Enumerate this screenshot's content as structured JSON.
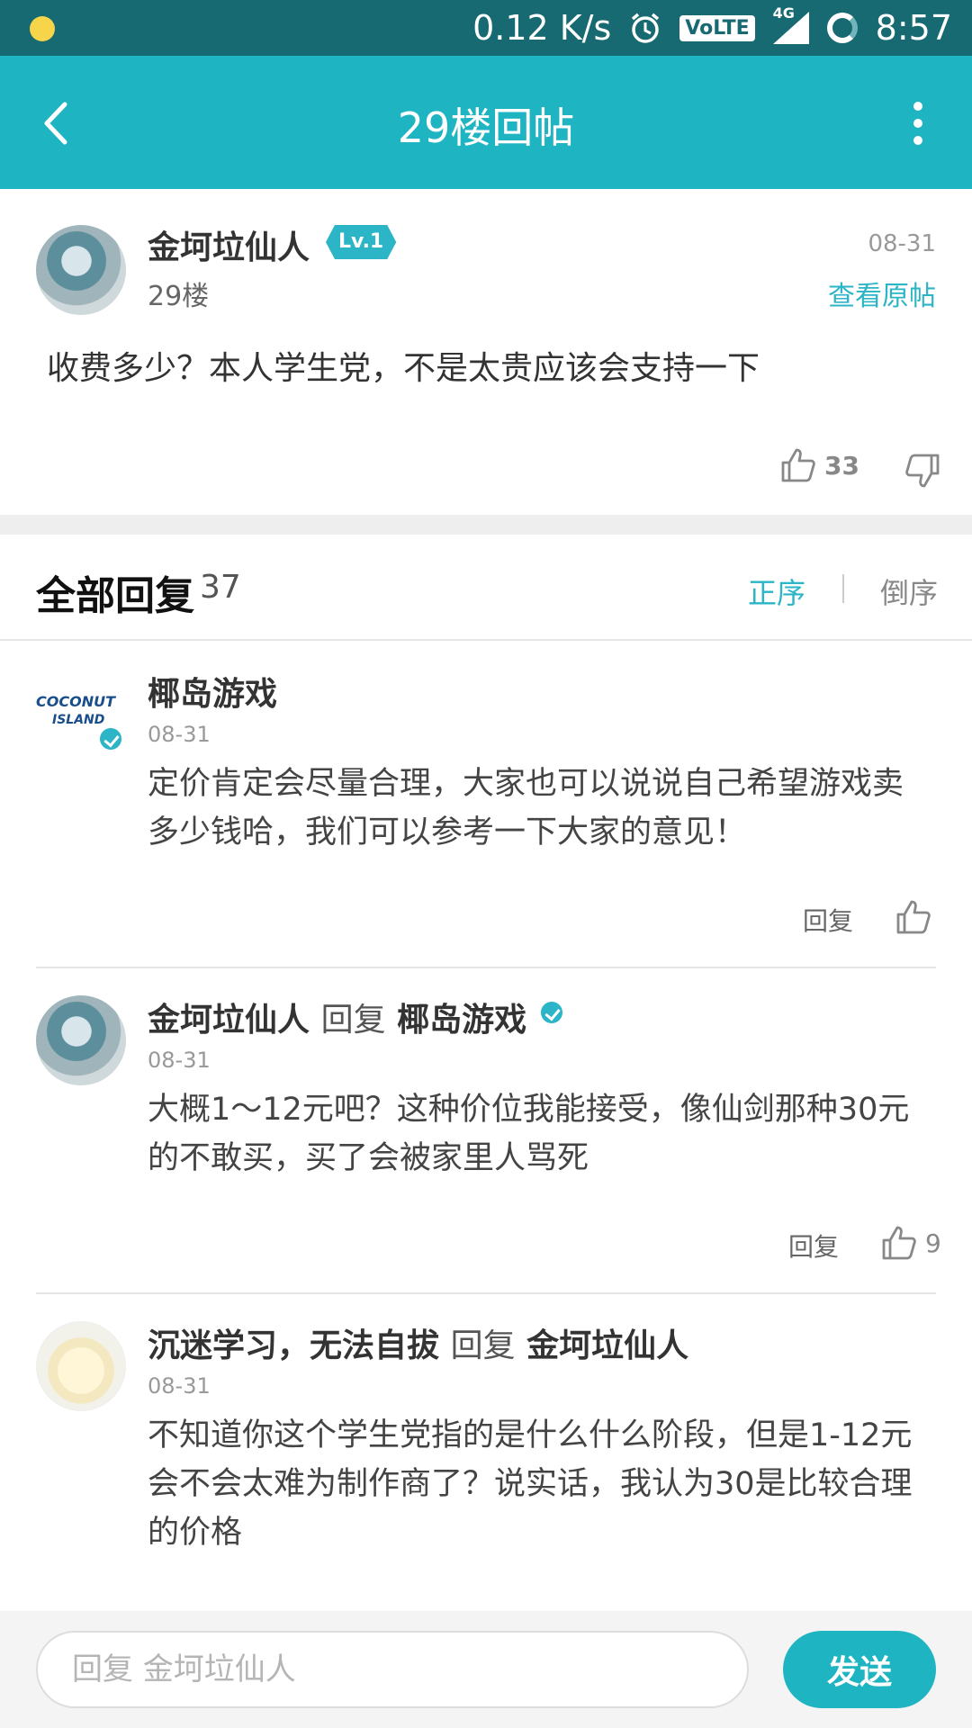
{
  "status_bar": {
    "speed": "0.12 K/s",
    "volte": "VoLTE",
    "network": "4G",
    "time": "8:57",
    "icons": [
      "notification-dot-icon",
      "alarm-icon",
      "volte-icon",
      "signal-icon",
      "loading-icon"
    ]
  },
  "app_bar": {
    "title": "29楼回帖",
    "back_icon": "back-arrow-icon",
    "more_icon": "more-vertical-icon"
  },
  "post": {
    "author": "金坷垃仙人",
    "level": "Lv.1",
    "floor": "29楼",
    "date": "08-31",
    "view_original": "查看原帖",
    "content": "收费多少？本人学生党，不是太贵应该会支持一下",
    "likes": "33"
  },
  "replies_header": {
    "title": "全部回复",
    "count": "37",
    "sort_asc": "正序",
    "sort_desc": "倒序"
  },
  "replies": [
    {
      "author": "椰岛游戏",
      "avatar_text_line1": "COCONUT",
      "avatar_text_line2": "ISLAND",
      "date": "08-31",
      "content": "定价肯定会尽量合理，大家也可以说说自己希望游戏卖多少钱哈，我们可以参考一下大家的意见！",
      "reply_label": "回复",
      "likes": ""
    },
    {
      "author": "金坷垃仙人",
      "reply_word": "回复",
      "reply_to": "椰岛游戏",
      "date": "08-31",
      "content": "大概1～12元吧？这种价位我能接受，像仙剑那种30元的不敢买，买了会被家里人骂死",
      "reply_label": "回复",
      "likes": "9"
    },
    {
      "author": "沉迷学习，无法自拔",
      "reply_word": "回复",
      "reply_to": "金坷垃仙人",
      "date": "08-31",
      "content": "不知道你这个学生党指的是什么什么阶段，但是1-12元会不会太难为制作商了？说实话，我认为30是比较合理的价格"
    }
  ],
  "input_bar": {
    "placeholder": "回复 金坷垃仙人",
    "value": "",
    "send_label": "发送"
  },
  "colors": {
    "status_bar": "#176a72",
    "app_bar": "#1fb4c2",
    "accent": "#2bb5c6"
  }
}
